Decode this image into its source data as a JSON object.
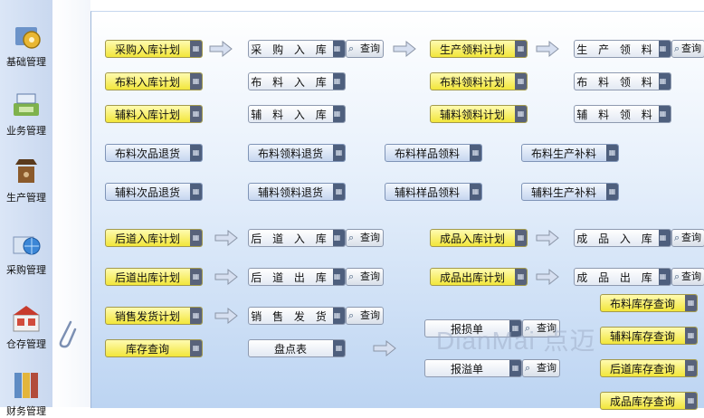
{
  "sidebar": {
    "items": [
      {
        "label": "基础管理",
        "icon": "gear-settings-icon"
      },
      {
        "label": "业务管理",
        "icon": "cash-register-icon"
      },
      {
        "label": "生产管理",
        "icon": "coffee-grinder-icon"
      },
      {
        "label": "采购管理",
        "icon": "globe-purchase-icon"
      },
      {
        "label": "仓存管理",
        "icon": "warehouse-boxes-icon"
      },
      {
        "label": "财务管理",
        "icon": "ledger-books-icon"
      }
    ]
  },
  "buttons": {
    "purchase_plan": "采购入库计划",
    "purchase_in": "采 购 入 库",
    "production_pick_plan": "生产领料计划",
    "production_pick": "生 产 领 料",
    "fabric_in_plan": "布料入库计划",
    "fabric_in": "布 料 入 库",
    "fabric_pick_plan": "布料领料计划",
    "fabric_pick": "布 料 领 料",
    "accessory_in_plan": "辅料入库计划",
    "accessory_in": "辅 料 入 库",
    "accessory_pick_plan": "辅料领料计划",
    "accessory_pick": "辅 料 领 料",
    "fabric_defect_return": "布料次品退货",
    "fabric_pick_return": "布料领料退货",
    "fabric_sample_pick": "布料样品领料",
    "fabric_prod_supplement": "布料生产补料",
    "accessory_defect_return": "辅料次品退货",
    "accessory_pick_return": "辅料领料退货",
    "accessory_sample_pick": "辅料样品领料",
    "accessory_prod_supplement": "辅料生产补料",
    "post_in_plan": "后道入库计划",
    "post_in": "后 道 入 库",
    "finished_in_plan": "成品入库计划",
    "finished_in": "成 品 入 库",
    "post_out_plan": "后道出库计划",
    "post_out": "后 道 出 库",
    "finished_out_plan": "成品出库计划",
    "finished_out": "成 品 出 库",
    "sales_plan": "销售发货计划",
    "sales_ship": "销 售 发 货",
    "fabric_stock_query": "布料库存查询",
    "stock_query": "库存查询",
    "inventory_sheet": "盘点表",
    "loss_report": "报损单",
    "accessory_stock_query": "辅料库存查询",
    "scrap_report": "报溢单",
    "post_stock_query": "后道库存查询",
    "finished_stock_query": "成品库存查询"
  },
  "query_label": "查询",
  "watermark": "DianMai 点迈"
}
